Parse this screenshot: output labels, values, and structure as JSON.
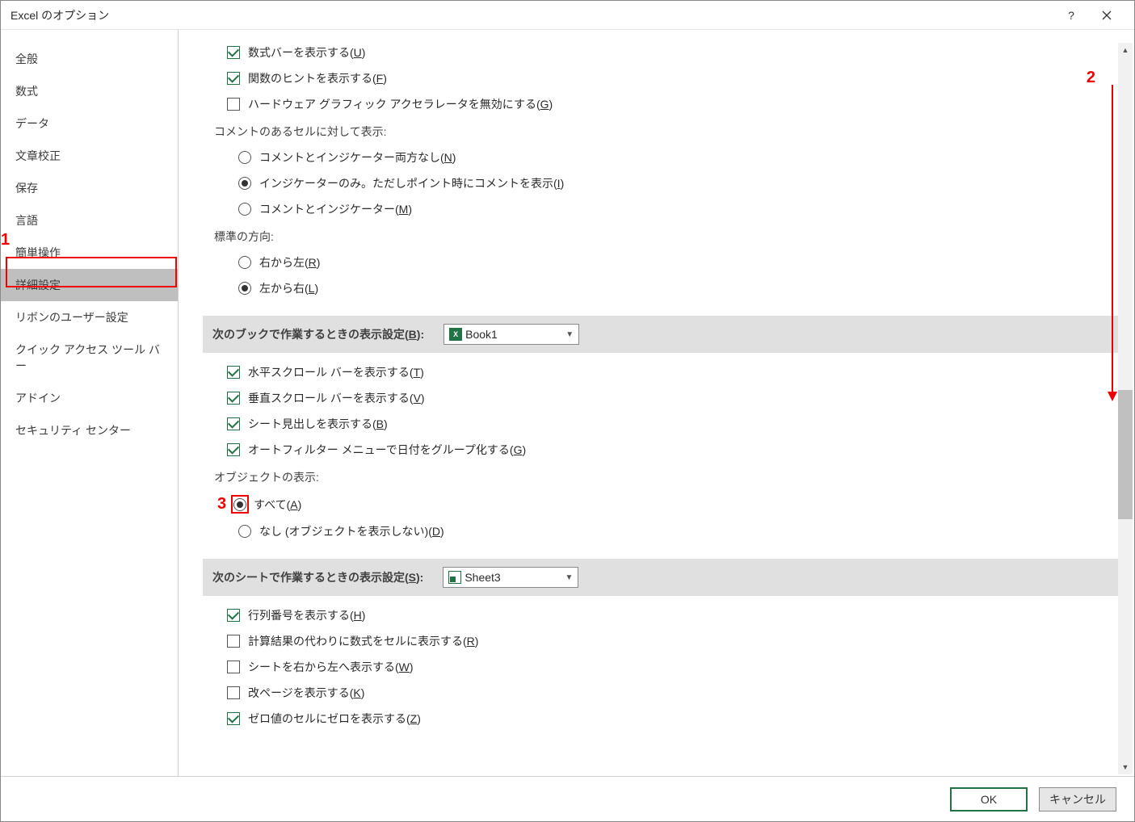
{
  "title": "Excel のオプション",
  "annotations": {
    "n1": "1",
    "n2": "2",
    "n3": "3"
  },
  "sidebar": [
    {
      "label": "全般"
    },
    {
      "label": "数式"
    },
    {
      "label": "データ"
    },
    {
      "label": "文章校正"
    },
    {
      "label": "保存"
    },
    {
      "label": "言語"
    },
    {
      "label": "簡単操作"
    },
    {
      "label": "詳細設定",
      "selected": true
    },
    {
      "label": "リボンのユーザー設定"
    },
    {
      "label": "クイック アクセス ツール バー"
    },
    {
      "label": "アドイン"
    },
    {
      "label": "セキュリティ センター"
    }
  ],
  "content": {
    "check1": {
      "label": "数式バーを表示する(",
      "acc": "U",
      "end": ")",
      "checked": true
    },
    "check2": {
      "label": "関数のヒントを表示する(",
      "acc": "F",
      "end": ")",
      "checked": true
    },
    "check3": {
      "label": "ハードウェア グラフィック アクセラレータを無効にする(",
      "acc": "G",
      "end": ")",
      "checked": false
    },
    "commentHead": "コメントのあるセルに対して表示:",
    "radioC1": {
      "label": "コメントとインジケーター両方なし(",
      "acc": "N",
      "end": ")",
      "sel": false
    },
    "radioC2": {
      "label": "インジケーターのみ。ただしポイント時にコメントを表示(",
      "acc": "I",
      "end": ")",
      "sel": true
    },
    "radioC3": {
      "label": "コメントとインジケーター(",
      "acc": "M",
      "end": ")",
      "sel": false
    },
    "dirHead": "標準の方向:",
    "radioD1": {
      "label": "右から左(",
      "acc": "R",
      "end": ")",
      "sel": false
    },
    "radioD2": {
      "label": "左から右(",
      "acc": "L",
      "end": ")",
      "sel": true
    },
    "section1": {
      "head": "次のブックで作業するときの表示設定(",
      "acc": "B",
      "end": "):",
      "dd": "Book1"
    },
    "checkB1": {
      "label": "水平スクロール バーを表示する(",
      "acc": "T",
      "end": ")",
      "checked": true
    },
    "checkB2": {
      "label": "垂直スクロール バーを表示する(",
      "acc": "V",
      "end": ")",
      "checked": true
    },
    "checkB3": {
      "label": "シート見出しを表示する(",
      "acc": "B",
      "end": ")",
      "checked": true
    },
    "checkB4": {
      "label": "オートフィルター メニューで日付をグループ化する(",
      "acc": "G",
      "end": ")",
      "checked": true
    },
    "objHead": "オブジェクトの表示:",
    "radioO1": {
      "label": "すべて(",
      "acc": "A",
      "end": ")",
      "sel": true
    },
    "radioO2": {
      "label": "なし (オブジェクトを表示しない)(",
      "acc": "D",
      "end": ")",
      "sel": false
    },
    "section2": {
      "head": "次のシートで作業するときの表示設定(",
      "acc": "S",
      "end": "):",
      "dd": "Sheet3"
    },
    "checkS1": {
      "label": "行列番号を表示する(",
      "acc": "H",
      "end": ")",
      "checked": true
    },
    "checkS2": {
      "label": "計算結果の代わりに数式をセルに表示する(",
      "acc": "R",
      "end": ")",
      "checked": false
    },
    "checkS3": {
      "label": "シートを右から左へ表示する(",
      "acc": "W",
      "end": ")",
      "checked": false
    },
    "checkS4": {
      "label": "改ページを表示する(",
      "acc": "K",
      "end": ")",
      "checked": false
    },
    "checkS5": {
      "label": "ゼロ値のセルにゼロを表示する(",
      "acc": "Z",
      "end": ")",
      "checked": true
    }
  },
  "footer": {
    "ok": "OK",
    "cancel": "キャンセル"
  }
}
